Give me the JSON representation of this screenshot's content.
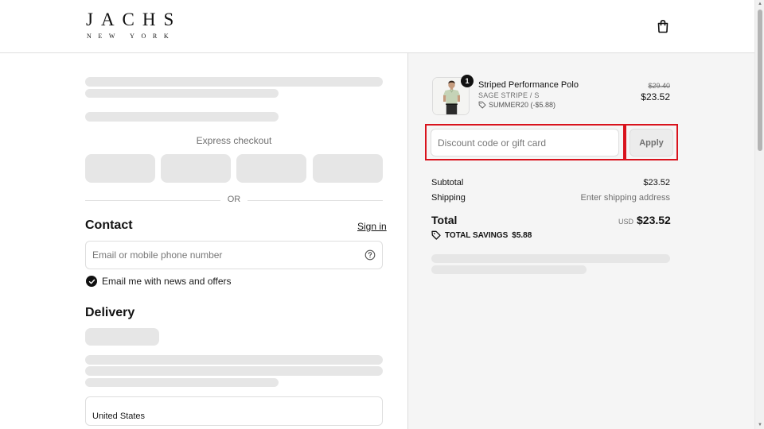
{
  "brand": {
    "name": "JACHS",
    "sub": "NEW YORK"
  },
  "express": {
    "label": "Express checkout"
  },
  "divider": {
    "label": "OR"
  },
  "contact": {
    "title": "Contact",
    "sign_in": "Sign in",
    "email_placeholder": "Email or mobile phone number",
    "newsletter_label": "Email me with news and offers",
    "newsletter_checked": true
  },
  "delivery": {
    "title": "Delivery",
    "country_value": "United States"
  },
  "cart": {
    "item": {
      "name": "Striped Performance Polo",
      "variant": "SAGE STRIPE / S",
      "discount": "SUMMER20 (-$5.88)",
      "original_price": "$29.40",
      "price": "$23.52",
      "quantity": "1"
    },
    "discount_placeholder": "Discount code or gift card",
    "apply_label": "Apply",
    "subtotal_label": "Subtotal",
    "subtotal_value": "$23.52",
    "shipping_label": "Shipping",
    "shipping_value": "Enter shipping address",
    "total_label": "Total",
    "currency": "USD",
    "total_value": "$23.52",
    "savings_label": "TOTAL SAVINGS",
    "savings_value": "$5.88"
  },
  "colors": {
    "accent_highlight": "#d9131d",
    "text": "#1a1a1a",
    "muted": "#707070",
    "skeleton": "#e6e6e6",
    "summary_bg": "#f5f5f5"
  }
}
